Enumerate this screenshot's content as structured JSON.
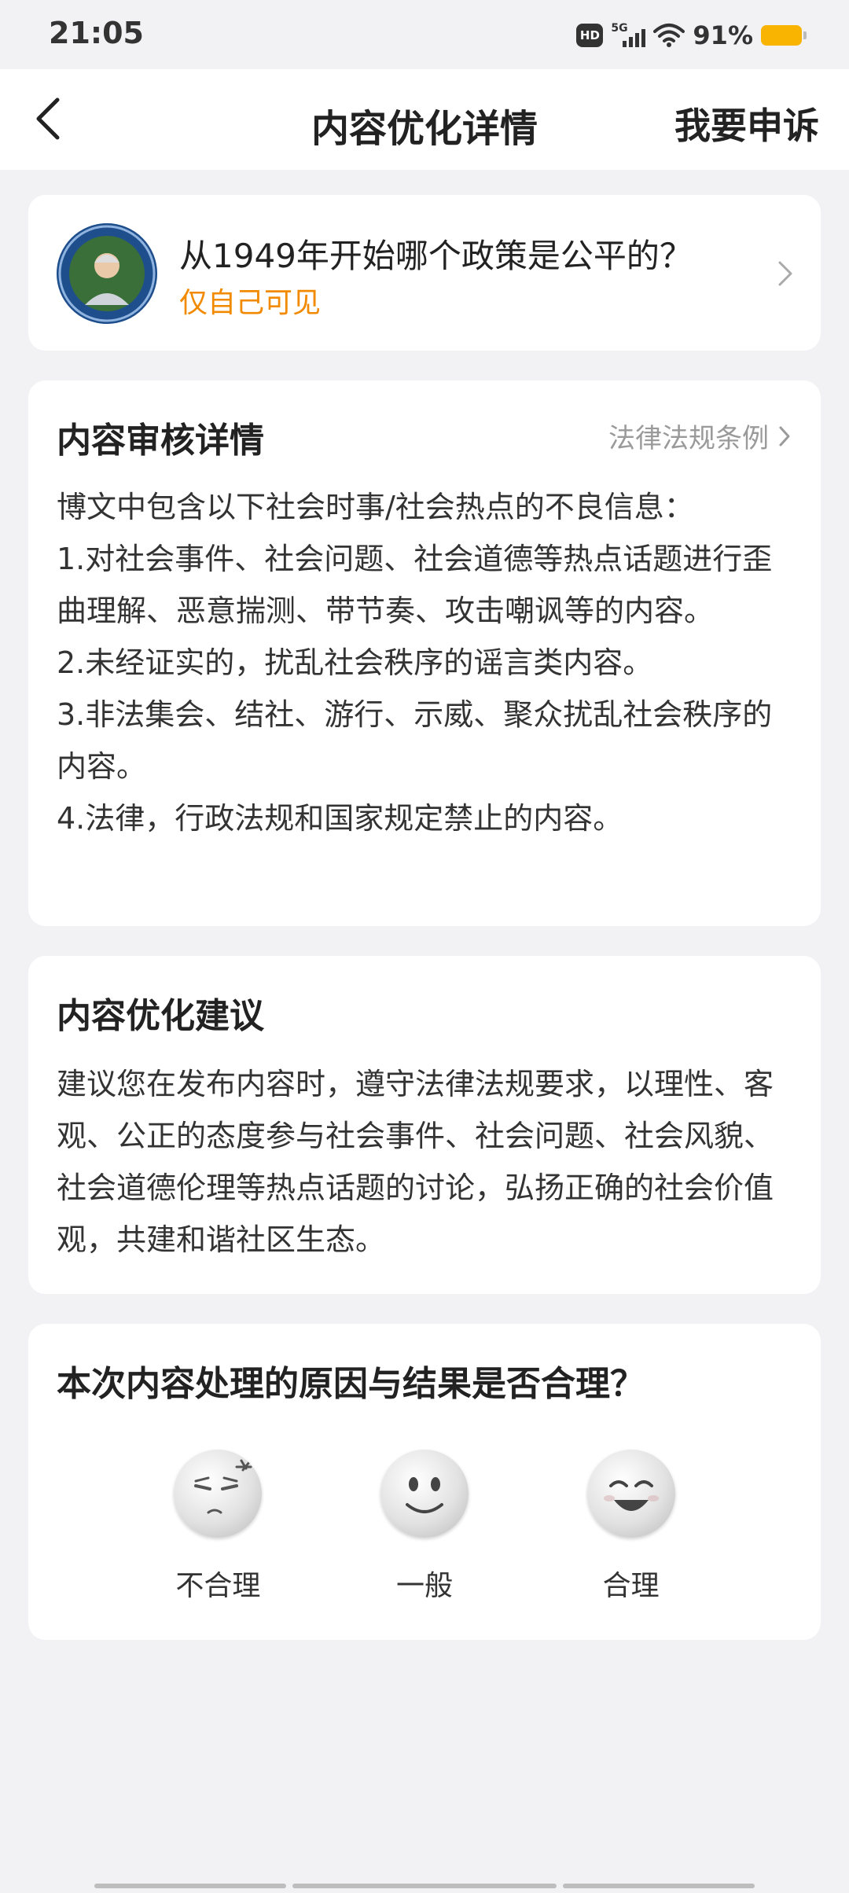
{
  "status_bar": {
    "time": "21:05",
    "hd_label": "HD",
    "network_label": "5G",
    "battery_percent": "91%",
    "battery_color": "#f8b400"
  },
  "header": {
    "back_icon": "chevron-left-icon",
    "title": "内容优化详情",
    "appeal_label": "我要申诉"
  },
  "post": {
    "title": "从1949年开始哪个政策是公平的？",
    "visibility": "仅自己可见",
    "visibility_color": "#f28a00"
  },
  "review": {
    "heading": "内容审核详情",
    "law_link": "法律法规条例",
    "paragraphs": [
      "博文中包含以下社会时事/社会热点的不良信息：",
      "1.对社会事件、社会问题、社会道德等热点话题进行歪曲理解、恶意揣测、带节奏、攻击嘲讽等的内容。",
      "2.未经证实的，扰乱社会秩序的谣言类内容。",
      "3.非法集会、结社、游行、示威、聚众扰乱社会秩序的内容。",
      "4.法律，行政法规和国家规定禁止的内容。"
    ]
  },
  "advice": {
    "heading": "内容优化建议",
    "text": "建议您在发布内容时，遵守法律法规要求，以理性、客观、公正的态度参与社会事件、社会问题、社会风貌、社会道德伦理等热点话题的讨论，弘扬正确的社会价值观，共建和谐社区生态。"
  },
  "rating": {
    "question": "本次内容处理的原因与结果是否合理？",
    "options": [
      {
        "label": "不合理",
        "icon": "annoyed-face-icon"
      },
      {
        "label": "一般",
        "icon": "neutral-face-icon"
      },
      {
        "label": "合理",
        "icon": "happy-face-icon"
      }
    ]
  }
}
